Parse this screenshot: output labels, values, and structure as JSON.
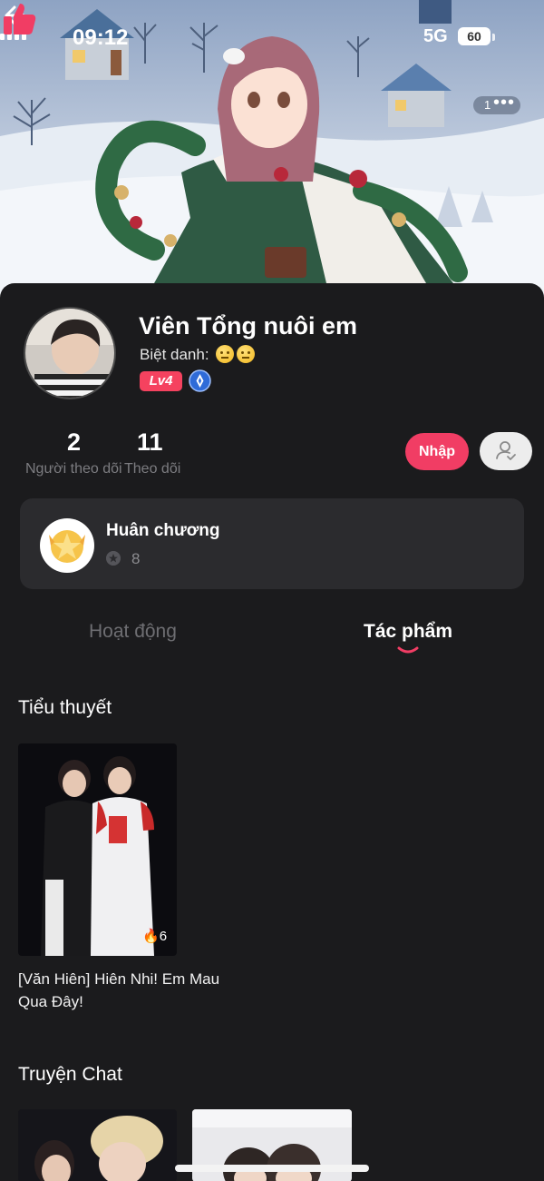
{
  "status_bar": {
    "time": "09:12",
    "network": "5G",
    "battery": "60"
  },
  "banner": {
    "like_count": "1"
  },
  "profile": {
    "name": "Viên Tổng nuôi em",
    "nickname_label": "Biệt danh:",
    "level_badge": "Lv4"
  },
  "stats": {
    "followers": {
      "count": "2",
      "label": "Người theo dõi"
    },
    "following": {
      "count": "11",
      "label": "Theo dõi"
    }
  },
  "actions": {
    "import_label": "Nhập"
  },
  "medals": {
    "title": "Huân chương",
    "count": "8"
  },
  "tabs": [
    {
      "label": "Hoạt động",
      "active": false
    },
    {
      "label": "Tác phẩm",
      "active": true
    }
  ],
  "sections": {
    "novels": {
      "title": "Tiểu thuyết",
      "items": [
        {
          "title": "[Văn Hiên] Hiên Nhi! Em Mau Qua Đây!",
          "hot_count": "6"
        }
      ]
    },
    "chat_stories": {
      "title": "Truyện Chat"
    }
  },
  "colors": {
    "accent": "#f13d64",
    "background": "#1b1b1d",
    "card": "#2b2b2e",
    "muted_text": "#7c7c80"
  },
  "icons": [
    "back-arrow-icon",
    "thumbs-up-icon",
    "more-dots-icon",
    "verified-icon",
    "user-check-icon",
    "medal-icon",
    "star-icon",
    "fire-icon",
    "signal-icon",
    "battery-icon"
  ]
}
